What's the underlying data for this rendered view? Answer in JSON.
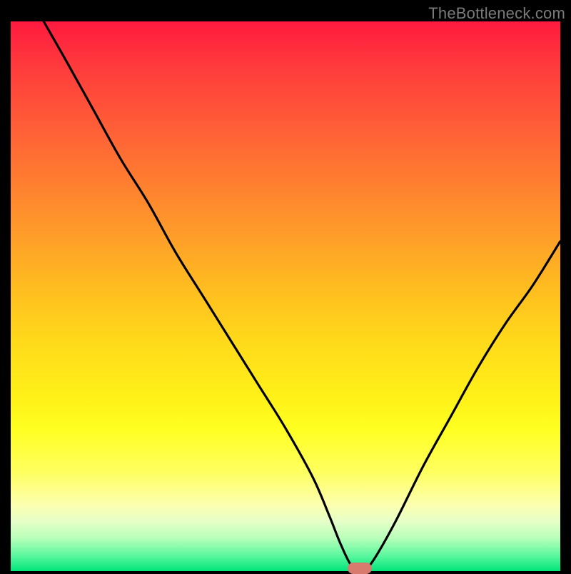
{
  "watermark": "TheBottleneck.com",
  "colors": {
    "page_bg": "#000000",
    "gradient_top": "#ff1a3f",
    "gradient_bottom": "#00e57a",
    "curve": "#000000",
    "marker": "#d87a6e"
  },
  "chart_data": {
    "type": "line",
    "title": "",
    "xlabel": "",
    "ylabel": "",
    "xlim": [
      0,
      100
    ],
    "ylim": [
      0,
      100
    ],
    "grid": false,
    "legend": false,
    "series": [
      {
        "name": "bottleneck-curve",
        "x": [
          6,
          10,
          15,
          20,
          25,
          30,
          35,
          40,
          45,
          50,
          55,
          58,
          60,
          62,
          64,
          66,
          70,
          75,
          80,
          85,
          90,
          95,
          100
        ],
        "values": [
          100,
          93,
          84,
          75,
          67,
          58,
          50,
          42,
          34,
          26,
          17,
          10,
          5,
          1,
          0,
          2,
          9,
          19,
          28,
          37,
          45,
          52,
          60
        ]
      }
    ],
    "annotations": [
      {
        "name": "minimum-marker",
        "x": 63.5,
        "y": 0.5
      }
    ]
  }
}
